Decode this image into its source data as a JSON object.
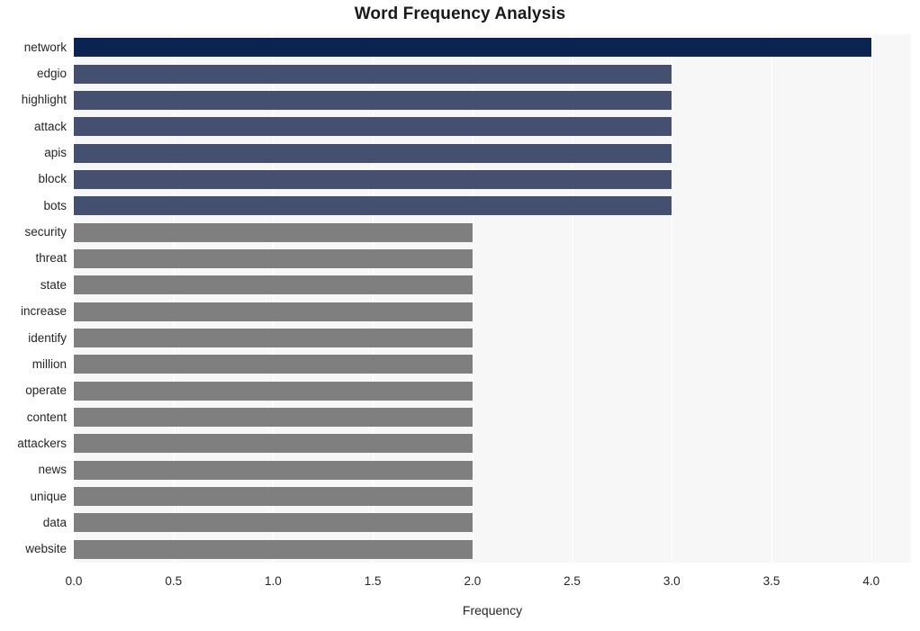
{
  "chart_data": {
    "type": "bar",
    "orientation": "horizontal",
    "title": "Word Frequency Analysis",
    "xlabel": "Frequency",
    "ylabel": "",
    "xlim": [
      0.0,
      4.2
    ],
    "xticks": [
      "0.0",
      "0.5",
      "1.0",
      "1.5",
      "2.0",
      "2.5",
      "3.0",
      "3.5",
      "4.0"
    ],
    "xtick_values": [
      0.0,
      0.5,
      1.0,
      1.5,
      2.0,
      2.5,
      3.0,
      3.5,
      4.0
    ],
    "grid": "vertical-only",
    "legend": "none",
    "categories": [
      "network",
      "edgio",
      "highlight",
      "attack",
      "apis",
      "block",
      "bots",
      "security",
      "threat",
      "state",
      "increase",
      "identify",
      "million",
      "operate",
      "content",
      "attackers",
      "news",
      "unique",
      "data",
      "website"
    ],
    "values": [
      4,
      3,
      3,
      3,
      3,
      3,
      3,
      2,
      2,
      2,
      2,
      2,
      2,
      2,
      2,
      2,
      2,
      2,
      2,
      2
    ],
    "bar_colors": [
      "#0a2350",
      "#454f70",
      "#454f70",
      "#454f70",
      "#454f70",
      "#454f70",
      "#454f70",
      "#7f7f7f",
      "#7f7f7f",
      "#7f7f7f",
      "#7f7f7f",
      "#7f7f7f",
      "#7f7f7f",
      "#7f7f7f",
      "#7f7f7f",
      "#7f7f7f",
      "#7f7f7f",
      "#7f7f7f",
      "#7f7f7f",
      "#7f7f7f"
    ]
  },
  "style": {
    "plot_background": "#f7f7f7",
    "figure_background": "#ffffff",
    "gridline_color": "#ffffff",
    "text_color": "#262626",
    "title_color": "#1a1a1a"
  }
}
